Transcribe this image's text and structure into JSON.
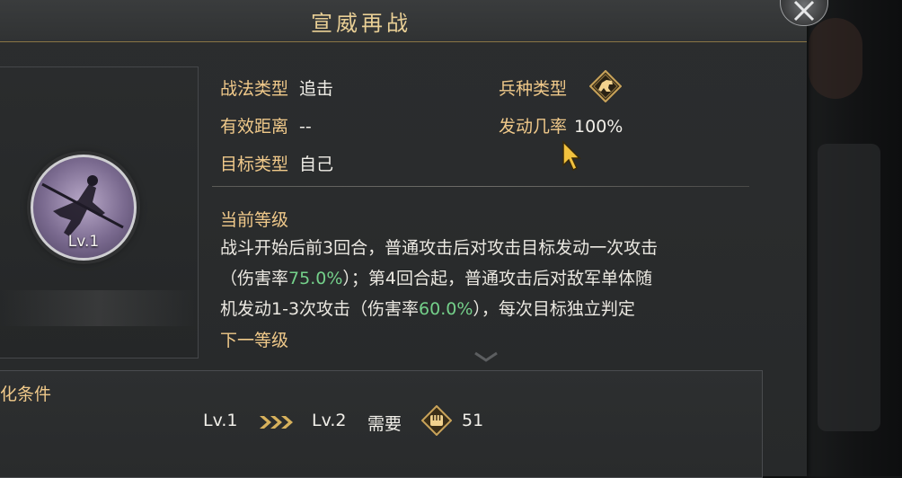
{
  "header": {
    "title": "宣威再战"
  },
  "skill": {
    "level": "Lv.1"
  },
  "info": {
    "tactic_type_label": "战法类型",
    "tactic_type_value": "追击",
    "range_label": "有效距离",
    "range_value": "--",
    "target_label": "目标类型",
    "target_value": "自己",
    "troop_type_label": "兵种类型",
    "trigger_rate_label": "发动几率",
    "trigger_rate_value": "100%"
  },
  "current_level": {
    "title": "当前等级",
    "desc_1": "战斗开始后前3回合，普通攻击后对攻击目标发动一次攻击",
    "desc_2a": "（伤害率",
    "desc_2b": "75.0%",
    "desc_2c": "）；第4回合起，普通攻击后对敌军单体随",
    "desc_3a": "机发动1-3次攻击（伤害率",
    "desc_3b": "60.0%",
    "desc_3c": "），每次目标独立判定"
  },
  "next_level": {
    "title": "下一等级"
  },
  "upgrade": {
    "label": "化条件",
    "from": "Lv.1",
    "to": "Lv.2",
    "need_label": "需要",
    "cost": "51"
  },
  "colors": {
    "gold": "#f0c98a",
    "green": "#74d08a",
    "panel": "#2b2d2e"
  },
  "icons": {
    "close": "close-icon",
    "troop": "horse-icon",
    "cost": "fist-icon",
    "arrows": "chevron-arrows-icon"
  }
}
